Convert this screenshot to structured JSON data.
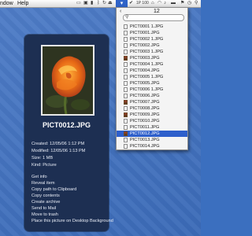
{
  "menubar": {
    "items": [
      "ndow",
      "Help"
    ],
    "tray_selected": "▾",
    "tray_value": "1P 100"
  },
  "file_menu": {
    "back": "‹",
    "count": "12",
    "search_placeholder": "",
    "files": [
      "PICT0001 1.JPG",
      "PICT0001.JPG",
      "PICT0002 1.JPG",
      "PICT0002.JPG",
      "PICT0003 1.JPG",
      "PICT0003.JPG",
      "PICT0004 1.JPG",
      "PICT0004.JPG",
      "PICT0005 1.JPG",
      "PICT0005.JPG",
      "PICT0006 1.JPG",
      "PICT0006.JPG",
      "PICT0007.JPG",
      "PICT0008.JPG",
      "PICT0009.JPG",
      "PICT0010.JPG",
      "PICT0011.JPG",
      "PICT0012.JPG",
      "PICT0013.JPG",
      "PICT0014.JPG"
    ],
    "selected_index": 17
  },
  "info": {
    "title": "PICT0012.JPG",
    "created": "Created: 12/05/06 1:12 PM",
    "modified": "Modified: 12/05/06 1:13 PM",
    "size": "Size: 1 MB",
    "kind": "Kind: Picture",
    "actions": [
      "Get info",
      "Reveal item",
      "Copy path to Clipboard",
      "Copy contents",
      "Create archive",
      "Send to Mail",
      "Move to trash",
      "Place this picture on Desktop Background"
    ]
  },
  "colors": {
    "desktop": "#3f71c2",
    "panel": "#1d2f52",
    "selection": "#2e5fcb"
  }
}
